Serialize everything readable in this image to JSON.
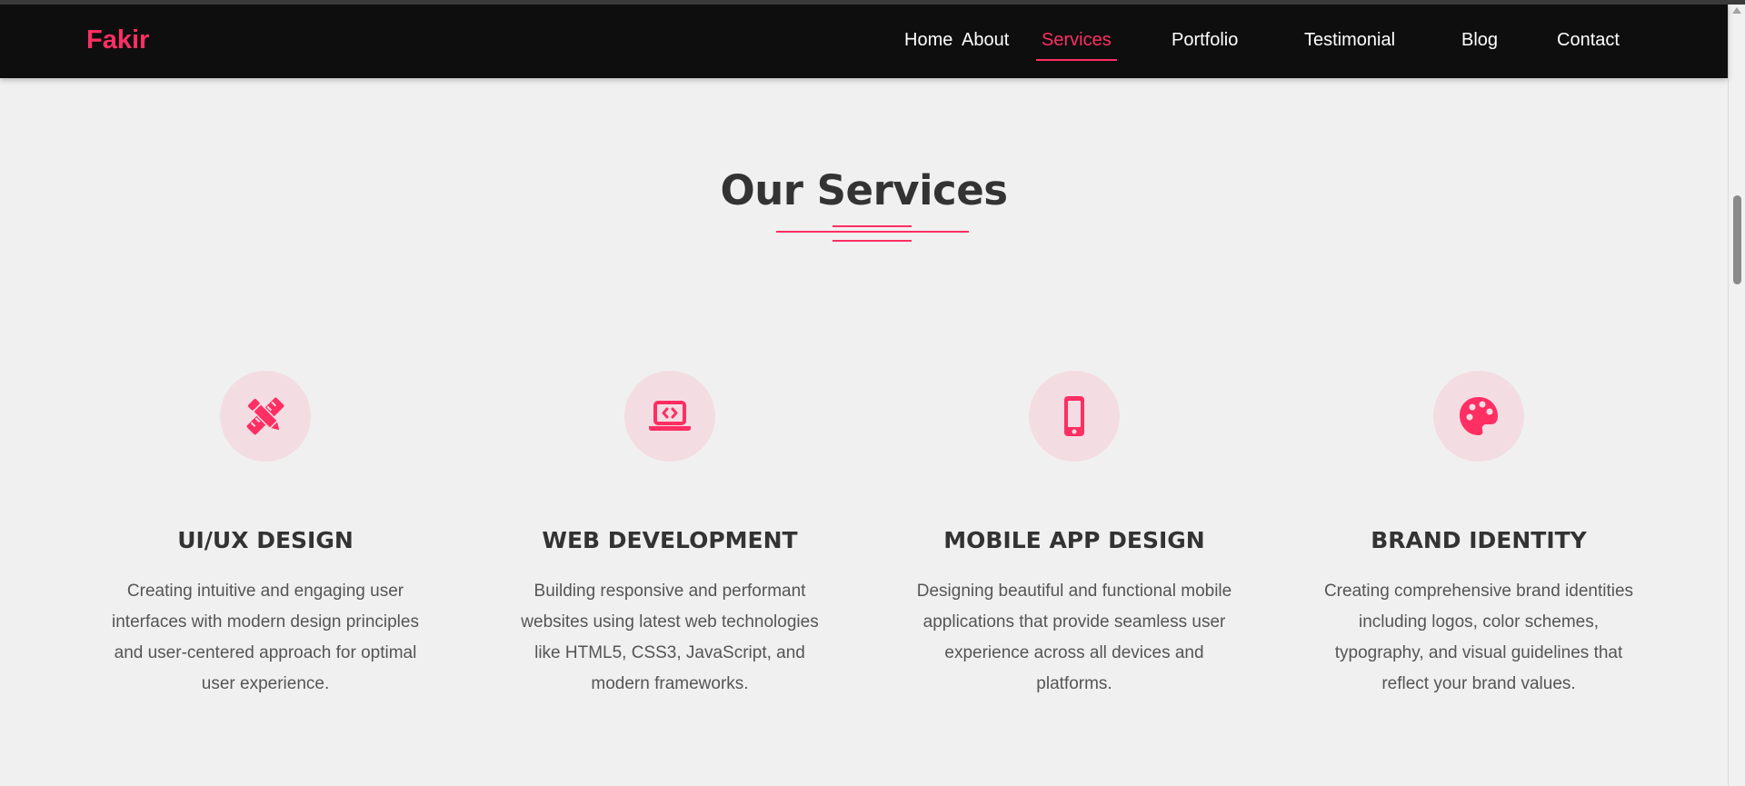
{
  "brand": {
    "logo": "Fakir",
    "accent_color": "#ff2e63"
  },
  "nav": {
    "items": [
      {
        "label": "Home"
      },
      {
        "label": "About"
      },
      {
        "label": "Services",
        "active": true
      },
      {
        "label": "Portfolio"
      },
      {
        "label": "Testimonial"
      },
      {
        "label": "Blog"
      },
      {
        "label": "Contact"
      }
    ]
  },
  "services": {
    "title": "Our Services",
    "cards": [
      {
        "icon": "pencil-ruler-icon",
        "title": "UI/UX DESIGN",
        "description": "Creating intuitive and engaging user interfaces with modern design principles and user-centered approach for optimal user experience."
      },
      {
        "icon": "laptop-code-icon",
        "title": "WEB DEVELOPMENT",
        "description": "Building responsive and performant websites using latest web technologies like HTML5, CSS3, JavaScript, and modern frameworks."
      },
      {
        "icon": "mobile-icon",
        "title": "MOBILE APP DESIGN",
        "description": "Designing beautiful and functional mobile applications that provide seamless user experience across all devices and platforms."
      },
      {
        "icon": "palette-icon",
        "title": "BRAND IDENTITY",
        "description": "Creating comprehensive brand identities including logos, color schemes, typography, and visual guidelines that reflect your brand values."
      }
    ]
  }
}
